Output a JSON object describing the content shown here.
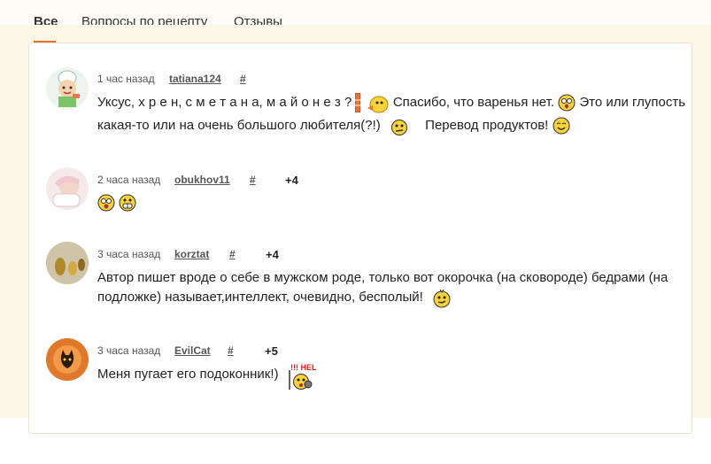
{
  "tabs": [
    {
      "label": "Все"
    },
    {
      "label": "Вопросы по рецепту"
    },
    {
      "label": "Отзывы"
    }
  ],
  "comments": [
    {
      "time": "1 час назад",
      "author": "tatiana124",
      "hash": "#",
      "rating": "",
      "line1a": "Уксус, х р е н, с м е т а н а, м а й о н е з ?",
      "line1b": "Спасибо, что варенья нет.",
      "line1c": "Это или глупость",
      "line2a": "какая-то или на очень большого любителя(?!)",
      "line2b": "Перевод продуктов!"
    },
    {
      "time": "2 часа назад",
      "author": "obukhov11",
      "hash": "#",
      "rating": "+4"
    },
    {
      "time": "3 часа назад",
      "author": "korztat",
      "hash": "#",
      "rating": "+4",
      "line1": "Автор пишет вроде о себе в мужском роде, только вот окорочка (на сковороде) бедрами (на",
      "line2": "подложке) называет,интеллект, очевидно, бесполый!"
    },
    {
      "time": "3 часа назад",
      "author": "EvilCat",
      "hash": "#",
      "rating": "+5",
      "line1": "Меня пугает его подоконник!)",
      "sign_text": "!!! HEL"
    }
  ],
  "colors": {
    "accent": "#e8722c",
    "page_bg": "#fdf7e7",
    "smiley": "#f7d23a"
  }
}
